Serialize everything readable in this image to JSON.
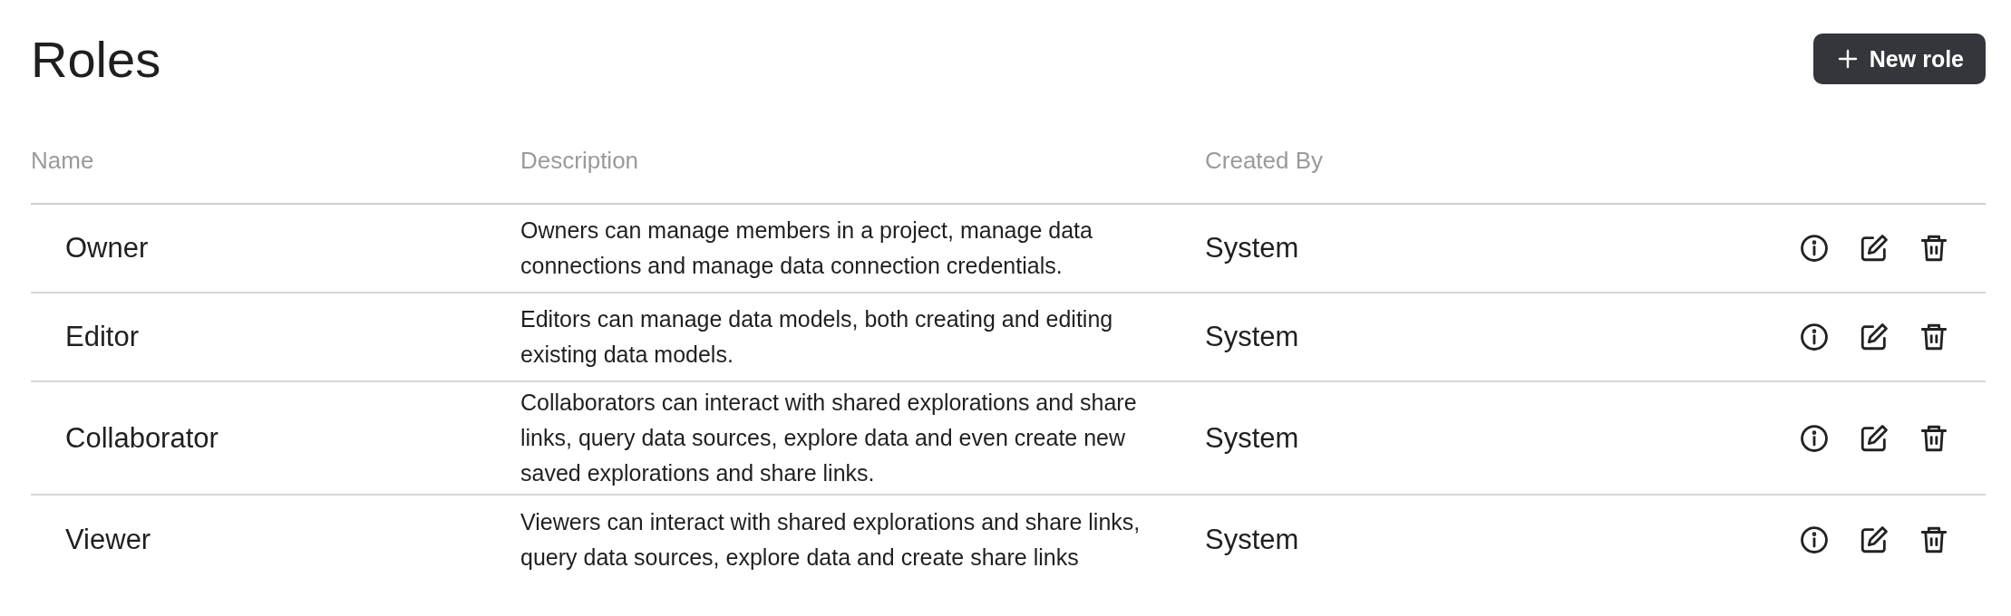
{
  "title": "Roles",
  "new_button": {
    "label": "New role"
  },
  "table": {
    "columns": [
      "Name",
      "Description",
      "Created By"
    ],
    "rows": [
      {
        "name": "Owner",
        "description": "Owners can manage members in a project, manage data connections and manage data connection credentials.",
        "created_by": "System"
      },
      {
        "name": "Editor",
        "description": "Editors can manage data models, both creating and editing existing data models.",
        "created_by": "System"
      },
      {
        "name": "Collaborator",
        "description": "Collaborators can interact with shared explorations and share links, query data sources, explore data and even create new saved explorations and share links.",
        "created_by": "System"
      },
      {
        "name": "Viewer",
        "description": "Viewers can interact with shared explorations and share links, query data sources, explore data and create share links",
        "created_by": "System"
      }
    ]
  }
}
